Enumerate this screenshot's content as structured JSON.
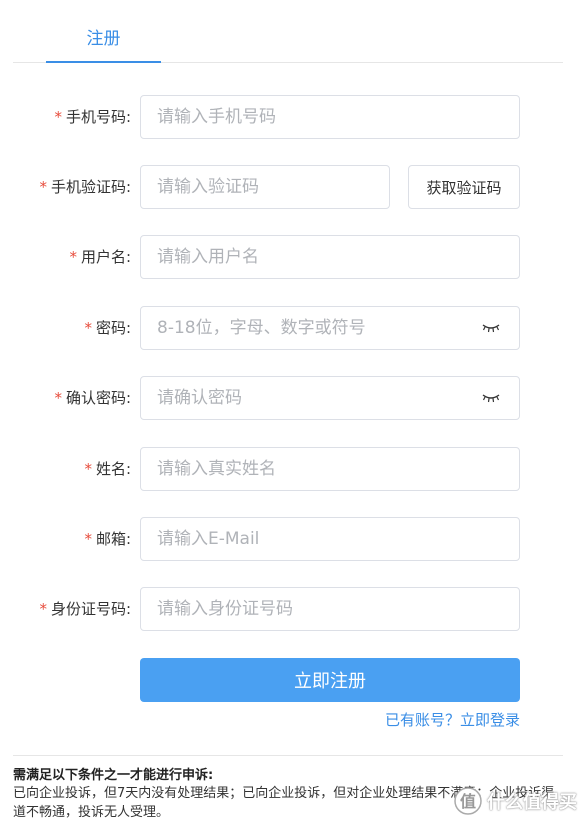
{
  "tabs": [
    {
      "label": "注册",
      "active": true
    }
  ],
  "form": {
    "phone": {
      "label": "手机号码:",
      "placeholder": "请输入手机号码"
    },
    "code": {
      "label": "手机验证码:",
      "placeholder": "请输入验证码",
      "button": "获取验证码"
    },
    "username": {
      "label": "用户名:",
      "placeholder": "请输入用户名"
    },
    "password": {
      "label": "密码:",
      "placeholder": "8-18位，字母、数字或符号",
      "icon": "eye-closed-icon"
    },
    "confirm": {
      "label": "确认密码:",
      "placeholder": "请确认密码",
      "icon": "eye-closed-icon"
    },
    "name": {
      "label": "姓名:",
      "placeholder": "请输入真实姓名"
    },
    "email": {
      "label": "邮箱:",
      "placeholder": "请输入E-Mail"
    },
    "idcard": {
      "label": "身份证号码:",
      "placeholder": "请输入身份证号码"
    },
    "required_mark": "*"
  },
  "submit_label": "立即注册",
  "login_link": "已有账号？立即登录",
  "notice": {
    "title": "需满足以下条件之一才能进行申诉:",
    "body": "已向企业投诉，但7天内没有处理结果；已向企业投诉，但对企业处理结果不满意；企业投诉渠道不畅通，投诉无人受理。"
  },
  "watermark": {
    "text": "什么值得买"
  },
  "colors": {
    "accent": "#3a8ee6",
    "button": "#4aa0f2",
    "required": "#e74c3c"
  }
}
